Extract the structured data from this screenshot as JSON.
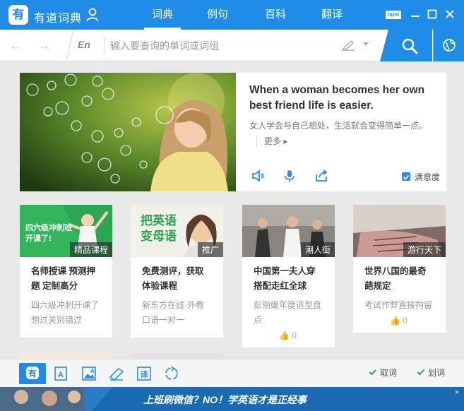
{
  "app": {
    "logo_text": "有",
    "name": "有道词典"
  },
  "nav": {
    "tabs": [
      {
        "label": "词典",
        "active": true
      },
      {
        "label": "例句"
      },
      {
        "label": "百科"
      },
      {
        "label": "翻译"
      }
    ]
  },
  "window": {
    "mini_label": "mini"
  },
  "search": {
    "lang": "En",
    "placeholder": "输入要查询的单词或词组"
  },
  "hero": {
    "sentence_en": "When a woman becomes her own best friend life is easier.",
    "sentence_cn": "女人学会与自己相处，生活就会变得简单一点。",
    "more": "更多",
    "satisfaction": "满意度"
  },
  "cards": [
    {
      "img_caption": "四六级冲刺班\n开课了!",
      "tag": "精品课程",
      "title": "名师授课 预测押题 定制高分",
      "desc": "四六级冲刺开课了 想过关别错过"
    },
    {
      "img_caption": "把英语\n变母语",
      "tag": "推广",
      "title": "免费测评，获取体验课程",
      "desc": "新东方在线-外教口语一对一"
    },
    {
      "tag": "潮人街",
      "title": "中国第一夫人穿搭配走红全球",
      "desc": "彭丽媛年度造型盘点",
      "likes": "0"
    },
    {
      "tag": "游行天下",
      "title": "世界八国的最奇葩规定",
      "desc": "考试作弊直接拘留",
      "likes": "0"
    }
  ],
  "bottom": {
    "wordbook": "取词",
    "select": "划词"
  },
  "ad": {
    "text": "上班刷微信？NO！学英语才是正经事"
  },
  "colors": {
    "brand": "#1f8de8",
    "white": "#ffffff"
  }
}
